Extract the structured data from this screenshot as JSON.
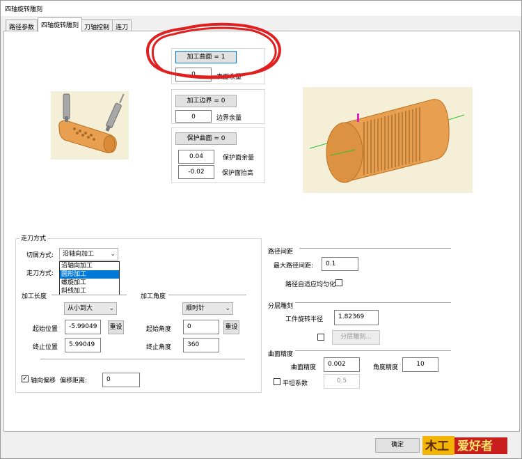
{
  "window": {
    "title": "四轴旋转雕刻"
  },
  "tabs": [
    "路径参数",
    "四轴旋转雕刻",
    "刀轴控制",
    "连刀"
  ],
  "surfaces": {
    "machining_btn": "加工曲面 = 1",
    "surface_allowance": "0",
    "surface_allowance_label": "表面余量",
    "boundary_btn": "加工边界 = 0",
    "boundary_allowance": "0",
    "boundary_allowance_label": "边界余量",
    "protect_btn": "保护曲面 = 0",
    "protect_allowance": "0.04",
    "protect_allowance_label": "保护面余量",
    "protect_lift": "-0.02",
    "protect_lift_label": "保护面抬高"
  },
  "tool_path": {
    "group_title": "走刀方式",
    "cut_mode_label": "切屑方式:",
    "cut_mode_value": "沿轴向加工",
    "cut_mode_options": [
      "沿轴向加工",
      "圆形加工",
      "螺旋加工",
      "斜线加工"
    ],
    "cut_mode_highlighted": "圆形加工",
    "walk_mode_label": "走刀方式:",
    "length_title": "加工长度",
    "length_order": "从小到大",
    "start_pos_label": "起始位置",
    "start_pos": "-5.99049",
    "end_pos_label": "终止位置",
    "end_pos": "5.99049",
    "reset_label": "重设",
    "angle_title": "加工角度",
    "angle_dir": "顺时针",
    "start_angle_label": "起始角度",
    "start_angle": "0",
    "end_angle_label": "终止角度",
    "end_angle": "360",
    "axial_offset_label": "轴向偏移",
    "offset_dist_label": "偏移距离:",
    "offset_dist": "0"
  },
  "path_spacing": {
    "title": "路径间距",
    "max_label": "最大路径间距:",
    "max_value": "0.1",
    "adaptive_label": "路径自适应均匀化"
  },
  "layered": {
    "title": "分层雕刻",
    "radius_label": "工件旋转半径",
    "radius_value": "1.82369",
    "btn": "分层雕刻..."
  },
  "precision": {
    "title": "曲面精度",
    "surface_label": "曲面精度",
    "surface_value": "0.002",
    "angle_label": "角度精度",
    "angle_value": "10",
    "smooth_label": "平坦系数",
    "smooth_value": "0.5"
  },
  "footer": {
    "ok": "确定",
    "logo_text": "爱好者",
    "logo_left": "木工"
  },
  "colors": {
    "annotation": "#e02020",
    "part": "#e8a050",
    "selection": "#0078d7"
  }
}
